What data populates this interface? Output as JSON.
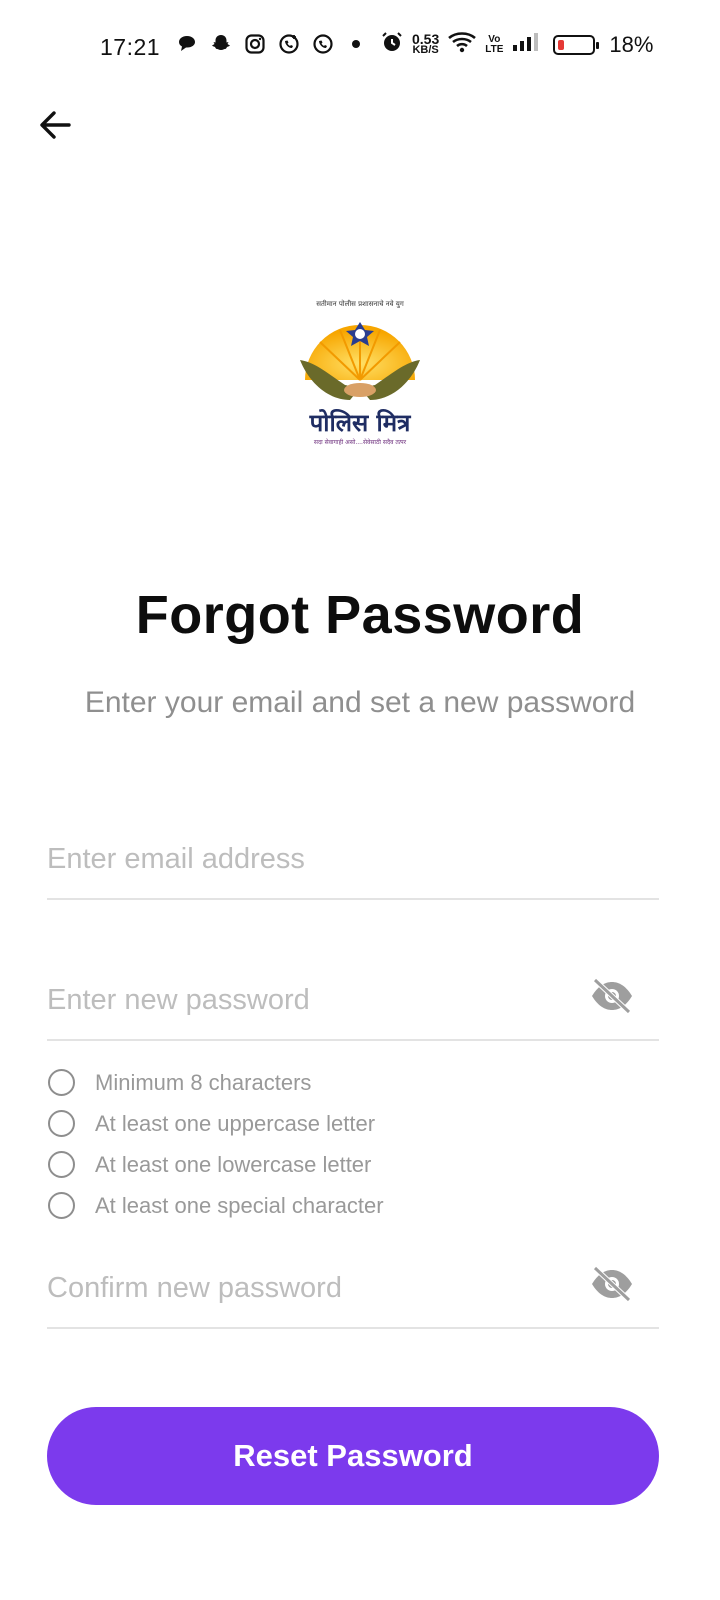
{
  "status_bar": {
    "time": "17:21",
    "net_speed_value": "0.53",
    "net_speed_unit": "KB/S",
    "volte_top": "Vo",
    "volte_bottom": "LTE",
    "battery_percent": "18%",
    "battery_level": 0.18,
    "battery_color": "#e53935",
    "notification_icons": [
      "chat-icon",
      "snapchat-icon",
      "instagram-icon",
      "whatsapp-business-icon",
      "whatsapp-icon"
    ]
  },
  "logo": {
    "arc_text": "सतीमान पोलीस प्रशासनाचे नवे युग",
    "name": "पोलिस मित्र",
    "tagline": "सदा सेवागाही असो....सेवेसाठी सदैव तत्पर"
  },
  "page": {
    "title": "Forgot Password",
    "subtitle": "Enter your email and set a new password"
  },
  "form": {
    "email_placeholder": "Enter email address",
    "new_password_placeholder": "Enter new password",
    "confirm_password_placeholder": "Confirm new password",
    "requirements": [
      "Minimum 8 characters",
      "At least one uppercase letter",
      "At least one lowercase letter",
      "At least one special character"
    ],
    "submit_label": "Reset Password"
  },
  "colors": {
    "accent": "#7c3aed",
    "placeholder": "#bdbdbd",
    "subtitle": "#8f8f8f"
  }
}
